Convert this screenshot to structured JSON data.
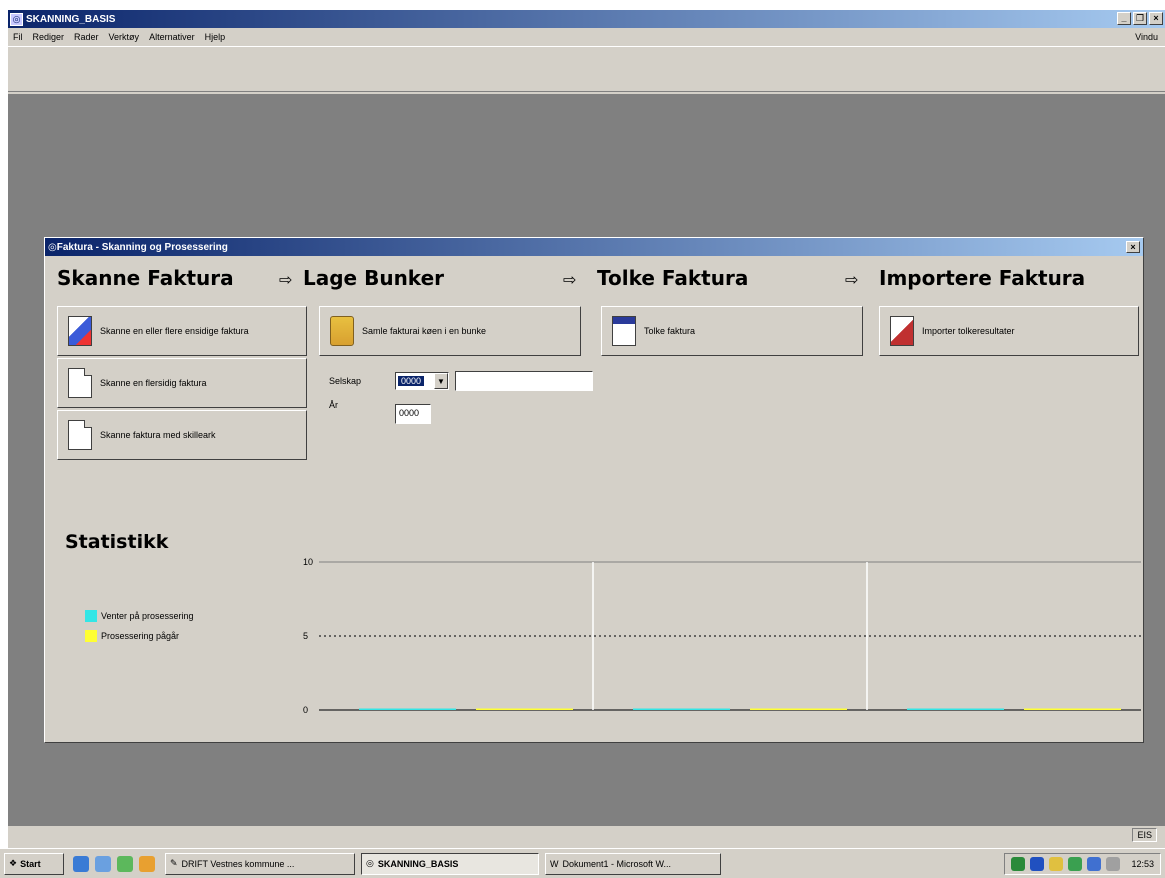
{
  "app": {
    "title": "SKANNING_BASIS",
    "menu": [
      "Fil",
      "Rediger",
      "Rader",
      "Verktøy",
      "Alternativer",
      "Hjelp"
    ],
    "menu_right": "Vindu"
  },
  "child_window": {
    "title": "Faktura - Skanning og Prosessering",
    "close": "×"
  },
  "sections": {
    "skanne": {
      "heading": "Skanne Faktura",
      "buttons": [
        "Skanne en eller flere ensidige faktura",
        "Skanne en flersidig faktura",
        "Skanne faktura med skilleark"
      ]
    },
    "lage": {
      "heading": "Lage Bunker",
      "button": "Samle fakturai køen i en bunke",
      "selskap_label": "Selskap",
      "selskap_value": "0000",
      "ar_label": "År",
      "ar_value": "0000"
    },
    "tolke": {
      "heading": "Tolke Faktura",
      "button": "Tolke faktura"
    },
    "importere": {
      "heading": "Importere Faktura",
      "button": "Importer tolkeresultater"
    },
    "arrow": "⇨"
  },
  "statistikk": {
    "title": "Statistikk",
    "legend": [
      {
        "label": "Venter på prosessering",
        "color": "#33e6e6"
      },
      {
        "label": "Prosessering pågår",
        "color": "#ffff33"
      }
    ]
  },
  "chart_data": {
    "type": "bar",
    "panels": 3,
    "ylim": [
      0,
      10
    ],
    "yticks": [
      "10",
      "5",
      "0"
    ],
    "series": [
      {
        "name": "Venter på prosessering",
        "color": "#33e6e6",
        "values": [
          0,
          0,
          0
        ]
      },
      {
        "name": "Prosessering pågår",
        "color": "#ffff33",
        "values": [
          0,
          0,
          0
        ]
      }
    ],
    "grid": "dotted midline"
  },
  "status": {
    "lang": "EIS"
  },
  "taskbar": {
    "start": "Start",
    "items": [
      "DRIFT Vestnes kommune ...",
      "SKANNING_BASIS",
      "Dokument1 - Microsoft W..."
    ],
    "clock": "12:53"
  }
}
